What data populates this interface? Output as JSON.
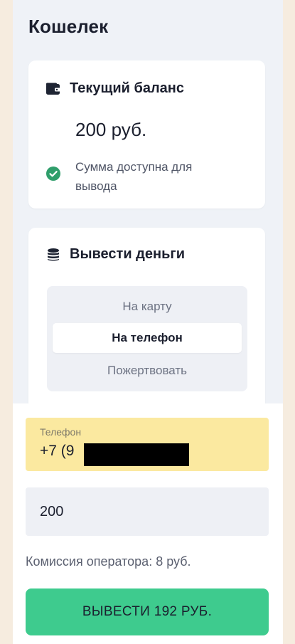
{
  "page": {
    "title": "Кошелек"
  },
  "balance_card": {
    "title": "Текущий баланс",
    "icon": "wallet-icon",
    "amount": "200 руб.",
    "status_text": "Сумма доступна для вывода",
    "status_icon": "check-circle-icon"
  },
  "withdraw_card": {
    "title": "Вывести деньги",
    "icon": "coins-icon",
    "options": [
      {
        "label": "На карту",
        "selected": false
      },
      {
        "label": "На телефон",
        "selected": true
      },
      {
        "label": "Пожертвовать",
        "selected": false
      }
    ]
  },
  "form": {
    "phone_label": "Телефон",
    "phone_value": "+7 (9",
    "amount_value": "200",
    "commission": "Комиссия оператора: 8 руб.",
    "submit_label": "ВЫВЕСТИ 192 РУБ."
  },
  "colors": {
    "background": "#f6ecdf",
    "screen": "#eff2f7",
    "accent_green": "#3ecb8e",
    "check_green": "#2f9e6b",
    "phone_field_highlight": "#fbe9a0"
  }
}
